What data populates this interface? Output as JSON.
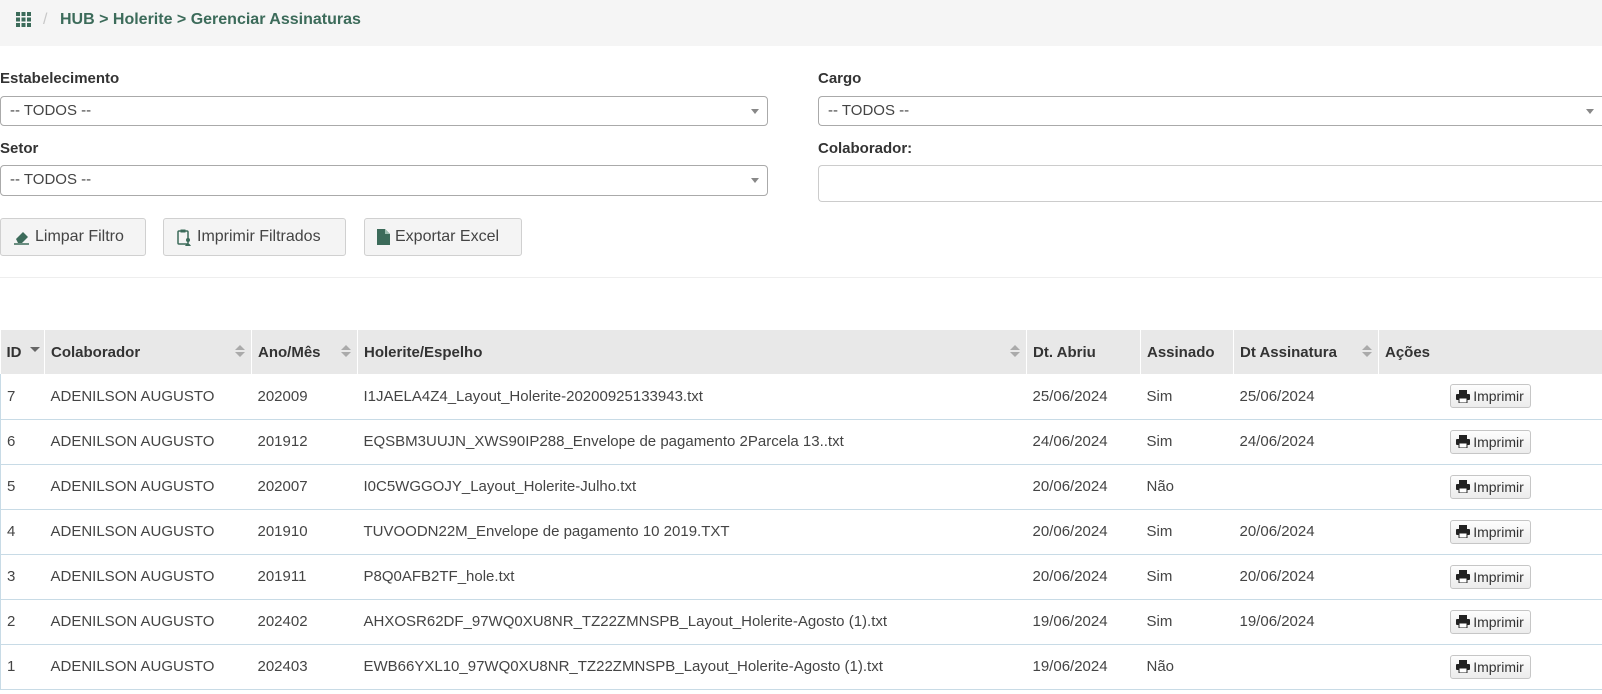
{
  "breadcrumb": {
    "separator": "/",
    "path": "HUB > Holerite > Gerenciar Assinaturas"
  },
  "filters": {
    "estabelecimento": {
      "label": "Estabelecimento",
      "value": "-- TODOS --"
    },
    "cargo": {
      "label": "Cargo",
      "value": "-- TODOS --"
    },
    "setor": {
      "label": "Setor",
      "value": "-- TODOS --"
    },
    "colaborador": {
      "label": "Colaborador:",
      "value": ""
    }
  },
  "buttons": {
    "limpar": "Limpar Filtro",
    "imprimir": "Imprimir Filtrados",
    "exportar": "Exportar Excel"
  },
  "table": {
    "headers": [
      "ID",
      "Colaborador",
      "Ano/Mês",
      "Holerite/Espelho",
      "Dt. Abriu",
      "Assinado",
      "Dt Assinatura",
      "Ações"
    ],
    "action_label": "Imprimir",
    "rows": [
      {
        "id": "7",
        "colaborador": "ADENILSON AUGUSTO",
        "ano_mes": "202009",
        "holerite": "I1JAELA4Z4_Layout_Holerite-20200925133943.txt",
        "dt_abriu": "25/06/2024",
        "assinado": "Sim",
        "dt_assinatura": "25/06/2024"
      },
      {
        "id": "6",
        "colaborador": "ADENILSON AUGUSTO",
        "ano_mes": "201912",
        "holerite": "EQSBM3UUJN_XWS90IP288_Envelope de pagamento 2Parcela 13..txt",
        "dt_abriu": "24/06/2024",
        "assinado": "Sim",
        "dt_assinatura": "24/06/2024"
      },
      {
        "id": "5",
        "colaborador": "ADENILSON AUGUSTO",
        "ano_mes": "202007",
        "holerite": "I0C5WGGOJY_Layout_Holerite-Julho.txt",
        "dt_abriu": "20/06/2024",
        "assinado": "Não",
        "dt_assinatura": ""
      },
      {
        "id": "4",
        "colaborador": "ADENILSON AUGUSTO",
        "ano_mes": "201910",
        "holerite": "TUVOODN22M_Envelope de pagamento 10 2019.TXT",
        "dt_abriu": "20/06/2024",
        "assinado": "Sim",
        "dt_assinatura": "20/06/2024"
      },
      {
        "id": "3",
        "colaborador": "ADENILSON AUGUSTO",
        "ano_mes": "201911",
        "holerite": "P8Q0AFB2TF_hole.txt",
        "dt_abriu": "20/06/2024",
        "assinado": "Sim",
        "dt_assinatura": "20/06/2024"
      },
      {
        "id": "2",
        "colaborador": "ADENILSON AUGUSTO",
        "ano_mes": "202402",
        "holerite": "AHXOSR62DF_97WQ0XU8NR_TZ22ZMNSPB_Layout_Holerite-Agosto (1).txt",
        "dt_abriu": "19/06/2024",
        "assinado": "Sim",
        "dt_assinatura": "19/06/2024"
      },
      {
        "id": "1",
        "colaborador": "ADENILSON AUGUSTO",
        "ano_mes": "202403",
        "holerite": "EWB66YXL10_97WQ0XU8NR_TZ22ZMNSPB_Layout_Holerite-Agosto (1).txt",
        "dt_abriu": "19/06/2024",
        "assinado": "Não",
        "dt_assinatura": ""
      }
    ]
  },
  "icons": {
    "apps": "grid-icon",
    "limpar": "eraser-icon",
    "imprimir": "clipboard-user-icon",
    "exportar": "file-icon",
    "print": "printer-icon"
  },
  "colors": {
    "accent": "#3c6b5a",
    "header_bg": "#e8e8e8",
    "row_border": "#c8dbe6"
  }
}
